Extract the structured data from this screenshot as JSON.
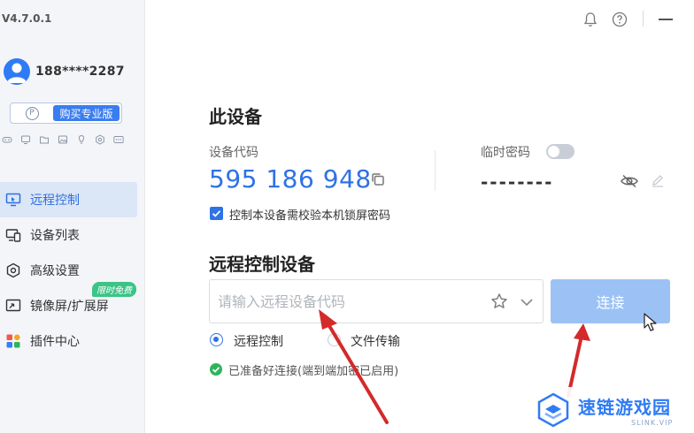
{
  "app": {
    "version": "V4.7.0.1"
  },
  "user": {
    "name": "188****2287",
    "buy_label": "购买专业版",
    "badge_letter": "P"
  },
  "quick_icons": [
    "gamepad-icon",
    "monitor-icon",
    "folder-icon",
    "image-icon",
    "bulb-icon",
    "settings-icon",
    "more-icon"
  ],
  "nav": {
    "items": [
      {
        "label": "远程控制",
        "icon": "remote-desktop-icon",
        "active": true
      },
      {
        "label": "设备列表",
        "icon": "devices-icon"
      },
      {
        "label": "高级设置",
        "icon": "hexagon-gear-icon"
      },
      {
        "label": "镜像屏/扩展屏",
        "icon": "mirror-screen-icon",
        "badge": "限时免费"
      },
      {
        "label": "插件中心",
        "icon": "plugins-icon"
      }
    ]
  },
  "this_device": {
    "title": "此设备",
    "code_label": "设备代码",
    "code": "595 186 948",
    "temp_password_label": "临时密码",
    "temp_password": "--------",
    "lockscreen_check_label": "控制本设备需校验本机锁屏密码",
    "lockscreen_checked": true,
    "temp_password_enabled": false
  },
  "remote": {
    "title": "远程控制设备",
    "input_placeholder": "请输入远程设备代码",
    "connect_label": "连接",
    "mode_remote_label": "远程控制",
    "mode_file_label": "文件传输",
    "selected_mode": "remote",
    "status_text": "已准备好连接(端到端加密已启用)"
  },
  "watermark": {
    "title": "速链游戏园",
    "sub": "SLINK.VIP"
  },
  "colors": {
    "accent": "#2f72e6",
    "connect_disabled": "#9cc2f5",
    "ok_green": "#2db55d",
    "arrow_red": "#d42a2a"
  }
}
